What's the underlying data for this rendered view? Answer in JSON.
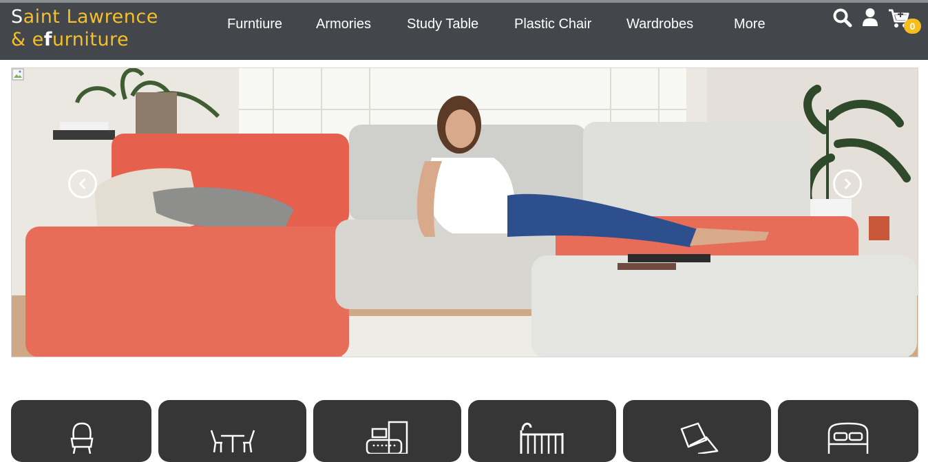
{
  "brand": {
    "line1_initial": "S",
    "line1_rest": "aint Lawrence",
    "line2_before": "& e",
    "line2_bold": "f",
    "line2_rest": "urniture"
  },
  "nav": {
    "items": [
      {
        "label": "Furntiure"
      },
      {
        "label": "Armories"
      },
      {
        "label": "Study Table"
      },
      {
        "label": "Plastic Chair"
      },
      {
        "label": "Wardrobes"
      },
      {
        "label": "More"
      }
    ]
  },
  "header_icons": [
    "search-icon",
    "user-icon",
    "cart-icon"
  ],
  "cart": {
    "count": "0"
  },
  "carousel": {
    "prev_icon": "chevron-left-icon",
    "next_icon": "chevron-right-icon"
  },
  "categories": [
    {
      "icon": "armchair-icon"
    },
    {
      "icon": "dining-set-icon"
    },
    {
      "icon": "study-desk-icon"
    },
    {
      "icon": "crib-icon"
    },
    {
      "icon": "pillows-icon"
    },
    {
      "icon": "bed-icon"
    }
  ],
  "colors": {
    "header_bg": "#43474b",
    "accent": "#f3bf2b",
    "badge": "#f4bf1e",
    "category_tile": "#363636"
  }
}
